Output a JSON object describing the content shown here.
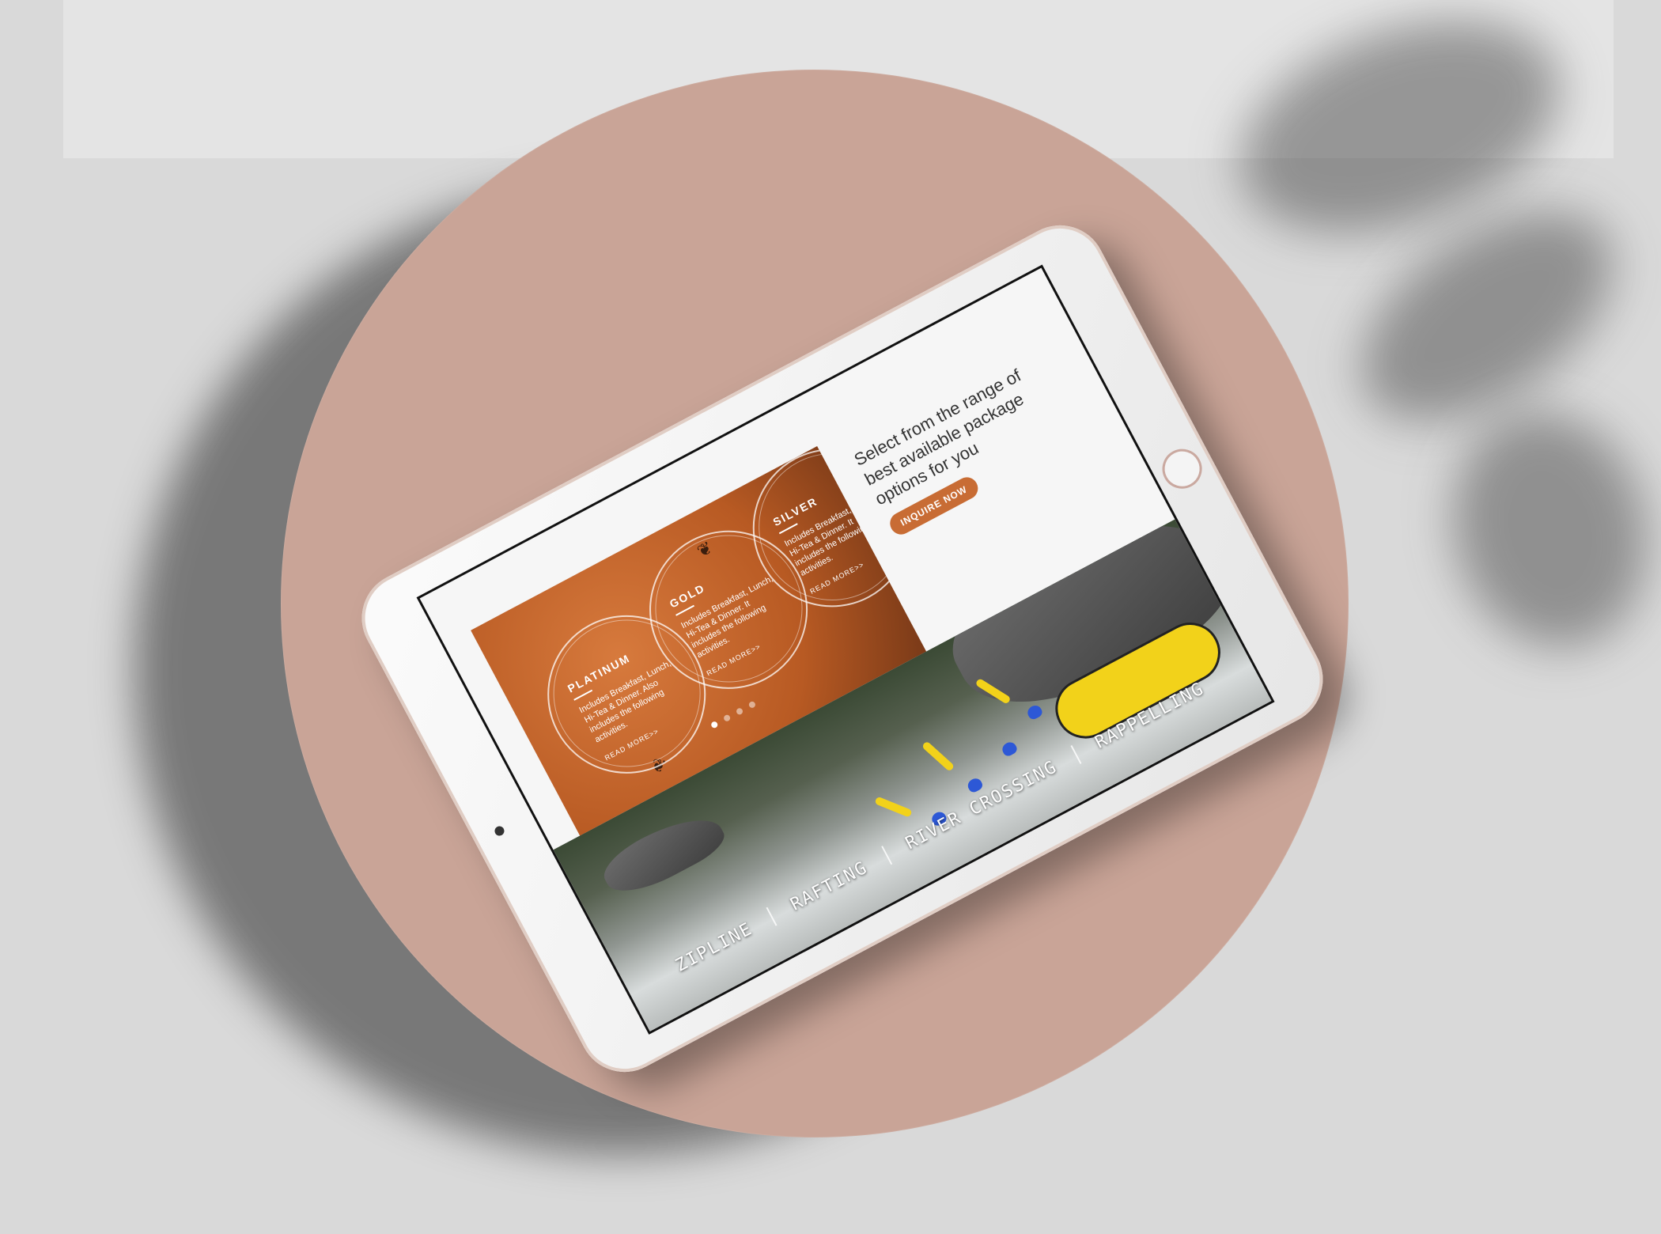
{
  "intro": {
    "headline": "Select from the range of best available package options for you",
    "cta_label": "INQUIRE NOW"
  },
  "packages": [
    {
      "title": "PLATINUM",
      "desc": "Includes Breakfast, Lunch, Hi-Tea & Dinner. Also includes the following activities.",
      "read_more": "READ MORE>>"
    },
    {
      "title": "GOLD",
      "desc": "Includes Breakfast, Lunch, Hi-Tea & Dinner. It includes the following activities.",
      "read_more": "READ MORE>>"
    },
    {
      "title": "SILVER",
      "desc": "Includes Breakfast, Lunch, Hi-Tea & Dinner. It includes the following activities.",
      "read_more": "READ MORE>>"
    }
  ],
  "carousel": {
    "count": 4,
    "active_index": 0
  },
  "activities": [
    "ZIPLINE",
    "RAFTING",
    "RIVER CROSSING",
    "RAPPELLING"
  ],
  "colors": {
    "accent": "#c86c34",
    "plate": "#c9a497",
    "background": "#d9d9d9"
  }
}
